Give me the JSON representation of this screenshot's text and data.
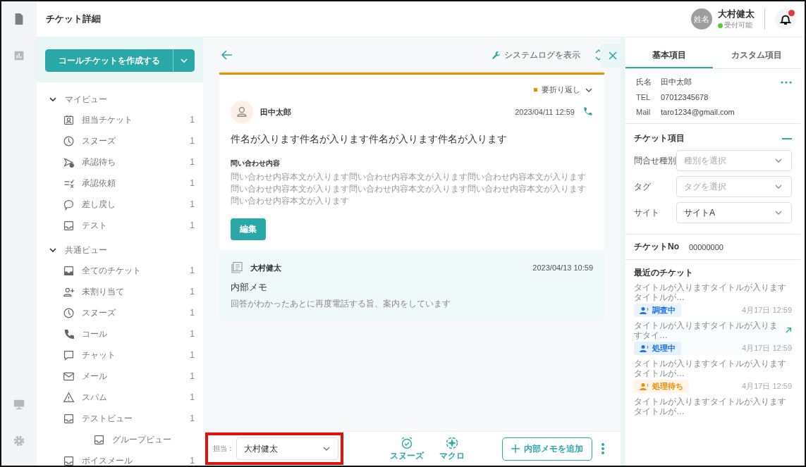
{
  "header": {
    "title": "チケット詳細",
    "user": {
      "avatar": "姓名",
      "name": "大村健太",
      "status": "受付可能",
      "online": true
    },
    "notification": true
  },
  "sidebar": {
    "create_button": "コールチケットを作成する",
    "groups": [
      {
        "label": "マイビュー",
        "expanded": true,
        "children": [
          {
            "label": "担当チケット",
            "count": "1"
          },
          {
            "label": "スヌーズ",
            "count": "1"
          },
          {
            "label": "承認待ち",
            "count": "1"
          },
          {
            "label": "承認依頼",
            "count": "1"
          },
          {
            "label": "差し戻し",
            "count": "1"
          },
          {
            "label": "テスト",
            "count": "1"
          }
        ]
      },
      {
        "label": "共通ビュー",
        "expanded": true,
        "children": [
          {
            "label": "全てのチケット",
            "count": "1"
          },
          {
            "label": "未割り当て",
            "count": "1"
          },
          {
            "label": "スヌーズ",
            "count": "1"
          },
          {
            "label": "コール",
            "count": "1"
          },
          {
            "label": "チャット",
            "count": "1"
          },
          {
            "label": "メール",
            "count": "1"
          },
          {
            "label": "スパム",
            "count": "1"
          },
          {
            "label": "テストビュー",
            "count": "1",
            "children": [
              {
                "label": "グループビュー"
              }
            ]
          },
          {
            "label": "ボイスメール",
            "count": "1"
          }
        ]
      }
    ]
  },
  "toolbar": {
    "system_log": "システムログを表示"
  },
  "ticket": {
    "priority": "要折り返し",
    "sender": "田中太郎",
    "datetime": "2023/04/11 12:59",
    "subject": "件名が入ります件名が入ります件名が入ります件名が入ります",
    "body_label": "問い合わせ内容",
    "body": "問い合わせ内容本文が入ります問い合わせ内容本文が入ります問い合わせ内容本文が入ります問い合わせ内容本文が入ります問い合わせ内容本文が入ります問い合わせ内容本文が入ります問い合わせ内容本文が入ります",
    "edit_button": "編集"
  },
  "memo": {
    "author": "大村健太",
    "datetime": "2023/04/13 10:59",
    "title": "内部メモ",
    "body": "回答がわかったあとに再度電話する旨、案内をしています"
  },
  "footer": {
    "assignee_label": "担当：",
    "assignee": "大村健太",
    "actions": [
      "スヌーズ",
      "マクロ"
    ],
    "add_memo": "内部メモを追加"
  },
  "right_panel": {
    "tabs": [
      {
        "label": "基本項目",
        "selected": true
      },
      {
        "label": "カスタム項目",
        "selected": false
      }
    ],
    "contact": [
      {
        "label": "氏名",
        "value": "田中太郎"
      },
      {
        "label": "TEL",
        "value": "07012345678"
      },
      {
        "label": "Mail",
        "value": "taro1234@gmail.com"
      }
    ],
    "ticket_fields": {
      "title": "チケット項目",
      "fields": [
        {
          "label": "問合せ種別",
          "placeholder": "種別を選択"
        },
        {
          "label": "タグ",
          "placeholder": "タグを選択"
        },
        {
          "label": "サイト",
          "value": "サイトA"
        }
      ]
    },
    "ticket_no": {
      "label": "チケットNo",
      "value": "00000000"
    },
    "recent": {
      "title": "最近のチケット",
      "items": [
        {
          "title": "タイトルが入りますタイトルが入りますタイトルが…",
          "status": "調査中",
          "color": "#1a73e8",
          "time": "4月17日 12:59",
          "hovered": false
        },
        {
          "title": "タイトルが入りますタイトルが入りますタイ…",
          "status": "処理中",
          "color": "#1a73e8",
          "time": "4月17日 12:59",
          "hovered": true
        },
        {
          "title": "タイトルが入りますタイトルが入りますタイトルが…",
          "status": "処理待ち",
          "color": "#f08c00",
          "time": "4月17日 12:59",
          "hovered": false
        },
        {
          "title": "タイトルが入りますタイトルが入りますタイトルが…",
          "hovered": false
        }
      ]
    }
  }
}
